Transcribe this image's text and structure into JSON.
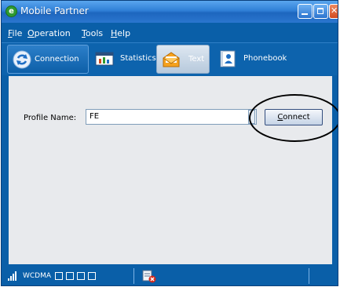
{
  "window": {
    "title": "Mobile Partner",
    "app_icon": "app-logo-icon",
    "controls": [
      "minimize-icon",
      "maximize-icon",
      "close-icon"
    ]
  },
  "menu": {
    "items": [
      {
        "label": "File"
      },
      {
        "label": "Operation"
      },
      {
        "label": "Tools"
      },
      {
        "label": "Help"
      }
    ]
  },
  "toolbar": {
    "tabs": [
      {
        "label": "Connection",
        "icon": "connection-icon"
      },
      {
        "label": "Statistics",
        "icon": "statistics-icon"
      },
      {
        "label": "Text",
        "icon": "envelope-icon",
        "selected": true
      },
      {
        "label": "Phonebook",
        "icon": "phonebook-icon"
      }
    ]
  },
  "main": {
    "profile_label": "Profile Name:",
    "profile_value": "FE",
    "connect_label": "Connect"
  },
  "status": {
    "network": "WCDMA",
    "signal_icon": "signal-strength-icon",
    "message_icon": "message-error-icon"
  },
  "colors": {
    "window_blue": "#0a5fa8",
    "content_bg": "#e8eaed"
  }
}
